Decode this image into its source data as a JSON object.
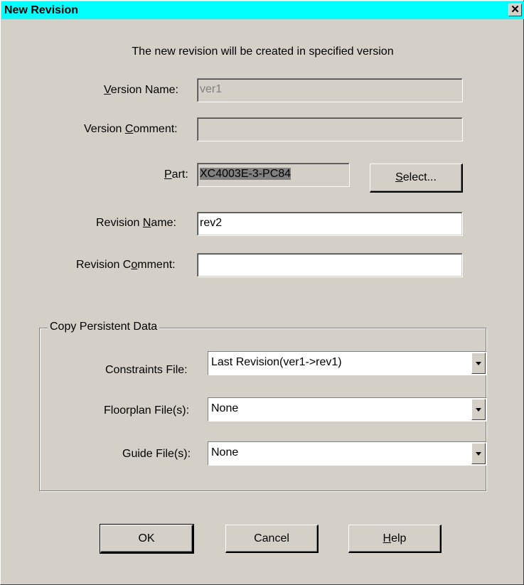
{
  "window": {
    "title": "New Revision",
    "close_glyph": "✕"
  },
  "intro_text": "The new revision will be created in specified version",
  "version_name": {
    "label_pre": "",
    "label_mnemonic": "V",
    "label_post": "ersion Name:",
    "value": "ver1"
  },
  "version_comment": {
    "label_pre": "Version ",
    "label_mnemonic": "C",
    "label_post": "omment:",
    "value": ""
  },
  "part": {
    "label_pre": "",
    "label_mnemonic": "P",
    "label_post": "art:",
    "value": "XC4003E-3-PC84"
  },
  "select_button": {
    "mnemonic": "S",
    "rest": "elect..."
  },
  "revision_name": {
    "label_pre": "Revision ",
    "label_mnemonic": "N",
    "label_post": "ame:",
    "value": "rev2"
  },
  "revision_comment": {
    "label_pre": "Revision C",
    "label_mnemonic": "o",
    "label_post": "mment:",
    "value": ""
  },
  "copy_group": {
    "title": "Copy Persistent Data",
    "constraints": {
      "label": "Constraints File:",
      "value": "Last Revision(ver1->rev1)"
    },
    "floorplan": {
      "label": "Floorplan File(s):",
      "value": "None"
    },
    "guide": {
      "label": "Guide File(s):",
      "value": "None"
    }
  },
  "buttons": {
    "ok": "OK",
    "cancel": "Cancel",
    "help_mnemonic": "H",
    "help_rest": "elp"
  },
  "colors": {
    "titlebar": "#00ffff",
    "face": "#d4d0c8",
    "disabled_text": "#808080"
  }
}
